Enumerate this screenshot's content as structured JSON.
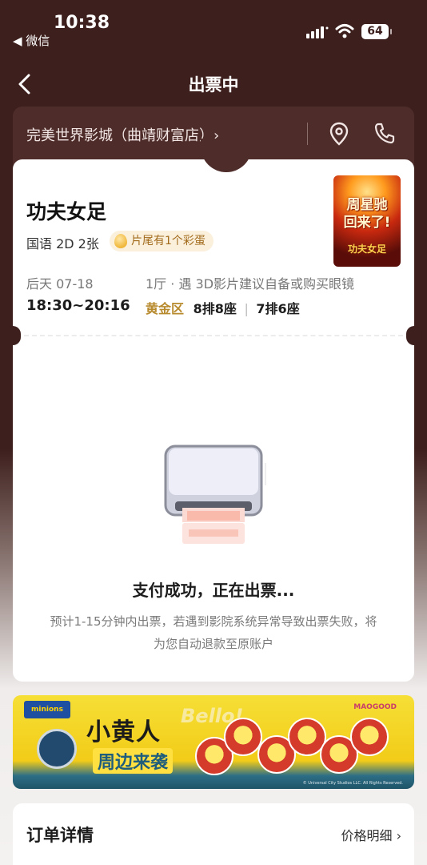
{
  "status_bar": {
    "time": "10:38",
    "back_app": "◀ 微信",
    "battery": "64"
  },
  "nav": {
    "title": "出票中"
  },
  "cinema": {
    "name": "完美世界影城（曲靖财富店）›"
  },
  "movie": {
    "title": "功夫女足",
    "meta": "国语 2D 2张",
    "egg_badge": "片尾有1个彩蛋",
    "poster_text": "周星驰\n回来了!",
    "poster_sub": "功夫女足",
    "date": "后天 07-18",
    "time": "18:30~20:16",
    "hall": "1厅 · 遇 3D影片建议自备或购买眼镜",
    "seat_zone": "黄金区",
    "seat1": "8排8座",
    "seat_sep": "|",
    "seat2": "7排6座"
  },
  "ticket_status": {
    "title": "支付成功，正在出票...",
    "desc": "预计1-15分钟内出票，若遇到影院系统异常导致出票失败，将为您自动退款至原账户"
  },
  "banner": {
    "logo": "minions",
    "bubble": "Bello!",
    "title_line1": "小黄人",
    "title_line2": "周边来袭",
    "brand": "MAOGOOD",
    "copyright": "© Universal City Studios LLC. All Rights Reserved."
  },
  "order": {
    "title": "订单详情",
    "price_link": "价格明细 ›"
  },
  "colors": {
    "header_bg": "#3d1f1d",
    "cinema_bar_bg": "#4e2c2a",
    "seat_zone": "#b78a2d",
    "egg_badge_bg": "#fbf0dc"
  },
  "icons": [
    "back-arrow-icon",
    "location-pin-icon",
    "phone-icon",
    "egg-icon",
    "ticket-printer-icon",
    "signal-icon",
    "wifi-icon",
    "battery-icon"
  ]
}
